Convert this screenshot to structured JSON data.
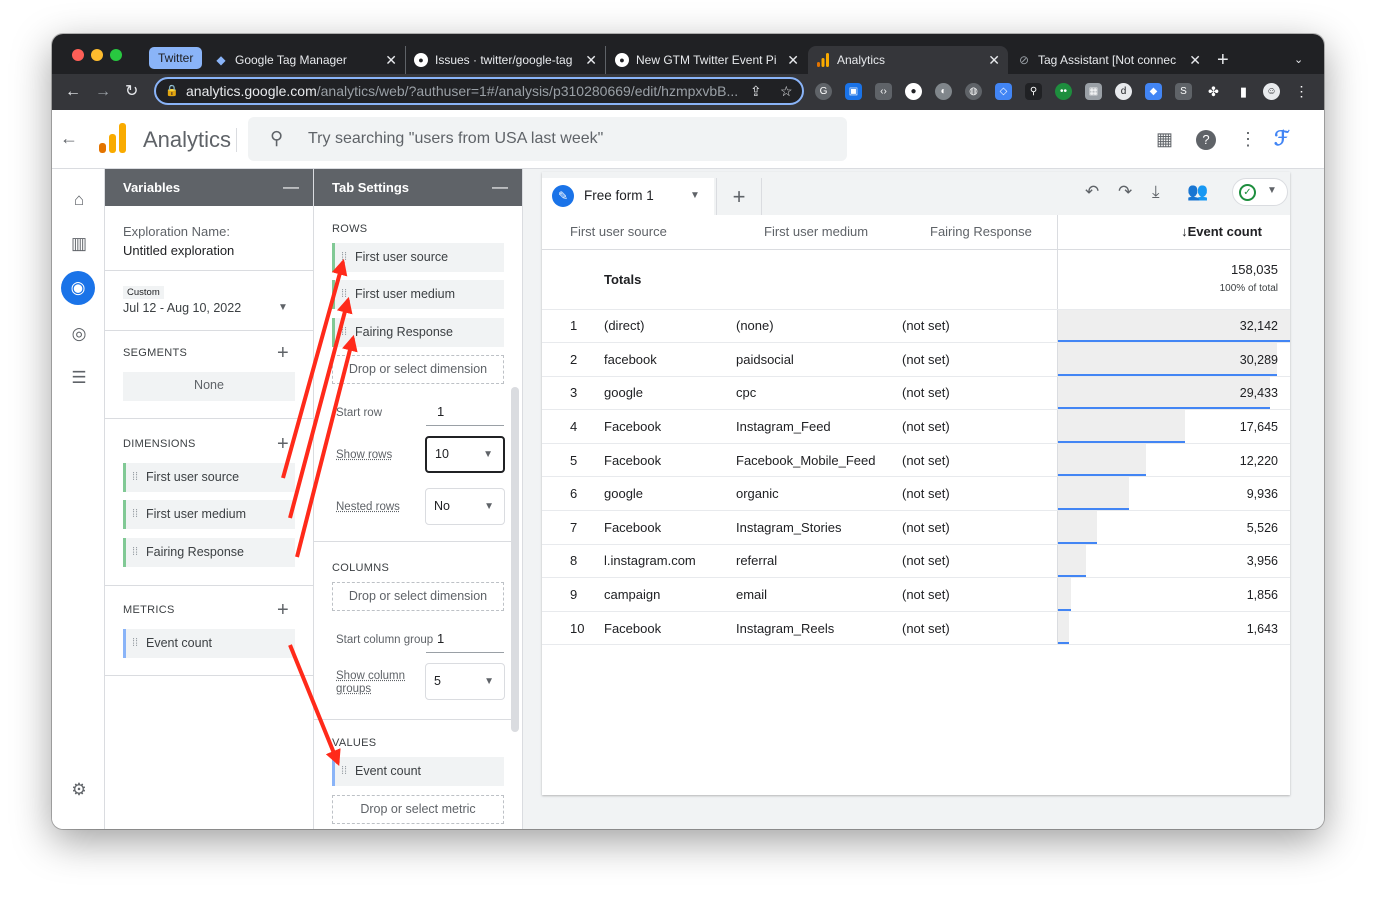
{
  "browser": {
    "group_label": "Twitter",
    "tabs": [
      {
        "title": "Google Tag Manager",
        "icon": "gtm-icon",
        "active": false
      },
      {
        "title": "Issues · twitter/google-tag",
        "icon": "github-icon",
        "active": false
      },
      {
        "title": "New GTM Twitter Event Pi",
        "icon": "github-icon",
        "active": false
      },
      {
        "title": "Analytics",
        "icon": "analytics-icon",
        "active": true
      },
      {
        "title": "Tag Assistant [Not connec",
        "icon": "tag-assistant-icon",
        "active": false
      }
    ],
    "url_host": "analytics.google.com",
    "url_path": "/analytics/web/?authuser=1#/analysis/p310280669/edit/hzmpxvbB..."
  },
  "app": {
    "name": "Analytics",
    "search_placeholder": "Try searching \"users from USA last week\""
  },
  "variables": {
    "header": "Variables",
    "exploration_label": "Exploration Name:",
    "exploration_name": "Untitled exploration",
    "date_badge": "Custom",
    "date_range": "Jul 12 - Aug 10, 2022",
    "segments_label": "SEGMENTS",
    "segments_none": "None",
    "dimensions_label": "DIMENSIONS",
    "dimensions": [
      "First user source",
      "First user medium",
      "Fairing Response"
    ],
    "metrics_label": "METRICS",
    "metrics": [
      "Event count"
    ]
  },
  "tab_settings": {
    "header": "Tab Settings",
    "rows_label": "ROWS",
    "rows": [
      "First user source",
      "First user medium",
      "Fairing Response"
    ],
    "drop_dimension": "Drop or select dimension",
    "start_row_label": "Start row",
    "start_row": "1",
    "show_rows_label": "Show rows",
    "show_rows": "10",
    "nested_rows_label": "Nested rows",
    "nested_rows": "No",
    "columns_label": "COLUMNS",
    "start_column_group_label": "Start column group",
    "start_column_group": "1",
    "show_column_groups_label_1": "Show column",
    "show_column_groups_label_2": "groups",
    "show_column_groups": "5",
    "values_label": "VALUES",
    "values": [
      "Event count"
    ],
    "drop_metric": "Drop or select metric"
  },
  "exploration": {
    "tab_name": "Free form 1",
    "columns": [
      "First user source",
      "First user medium",
      "Fairing Response",
      "↓Event count"
    ],
    "totals_label": "Totals",
    "totals_value": "158,035",
    "totals_pct": "100% of total",
    "rows": [
      {
        "rank": "1",
        "source": "(direct)",
        "medium": "(none)",
        "response": "(not set)",
        "count": "32,142",
        "value": 32142
      },
      {
        "rank": "2",
        "source": "facebook",
        "medium": "paidsocial",
        "response": "(not set)",
        "count": "30,289",
        "value": 30289
      },
      {
        "rank": "3",
        "source": "google",
        "medium": "cpc",
        "response": "(not set)",
        "count": "29,433",
        "value": 29433
      },
      {
        "rank": "4",
        "source": "Facebook",
        "medium": "Instagram_Feed",
        "response": "(not set)",
        "count": "17,645",
        "value": 17645
      },
      {
        "rank": "5",
        "source": "Facebook",
        "medium": "Facebook_Mobile_Feed",
        "response": "(not set)",
        "count": "12,220",
        "value": 12220
      },
      {
        "rank": "6",
        "source": "google",
        "medium": "organic",
        "response": "(not set)",
        "count": "9,936",
        "value": 9936
      },
      {
        "rank": "7",
        "source": "Facebook",
        "medium": "Instagram_Stories",
        "response": "(not set)",
        "count": "5,526",
        "value": 5526
      },
      {
        "rank": "8",
        "source": "l.instagram.com",
        "medium": "referral",
        "response": "(not set)",
        "count": "3,956",
        "value": 3956
      },
      {
        "rank": "9",
        "source": "campaign",
        "medium": "email",
        "response": "(not set)",
        "count": "1,856",
        "value": 1856
      },
      {
        "rank": "10",
        "source": "Facebook",
        "medium": "Instagram_Reels",
        "response": "(not set)",
        "count": "1,643",
        "value": 1643
      }
    ],
    "max_value": 32142
  },
  "colors": {
    "accent": "#1a73e8",
    "annotation_arrow": "#ff2a1a",
    "bar_line": "#4285f4"
  }
}
